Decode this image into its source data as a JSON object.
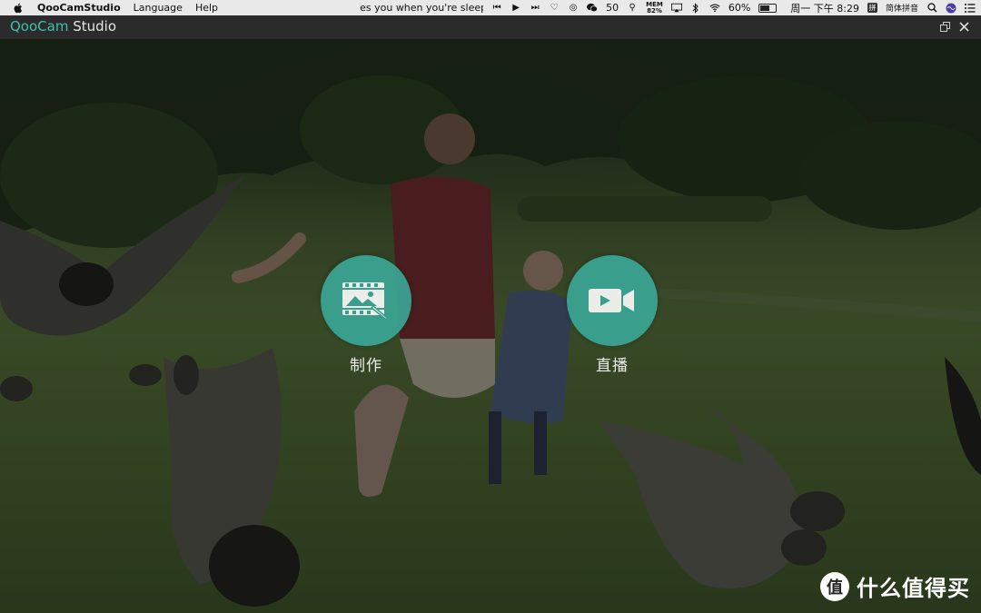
{
  "menubar": {
    "app_name": "QooCamStudio",
    "menus": [
      "Language",
      "Help"
    ],
    "now_playing": "es you when you're sleeping",
    "wechat_count": "50",
    "mem_label": "MEM",
    "mem_value": "82%",
    "battery": "60%",
    "battery_fill": 0.6,
    "clock": "周一 下午 8:29",
    "input_method": "简体拼音",
    "ime_icon_char": "拼"
  },
  "titlebar": {
    "logo_q": "Qoo",
    "logo_cam": "Cam",
    "logo_studio": "Studio"
  },
  "actions": {
    "create": {
      "label": "制作",
      "icon": "film-edit-icon"
    },
    "live": {
      "label": "直播",
      "icon": "video-camera-icon"
    }
  },
  "watermark": {
    "badge": "值",
    "text": "什么值得买"
  },
  "colors": {
    "accent": "#3aa897",
    "titlebar": "#2b2b2b",
    "menubar": "#e9e9e9"
  }
}
